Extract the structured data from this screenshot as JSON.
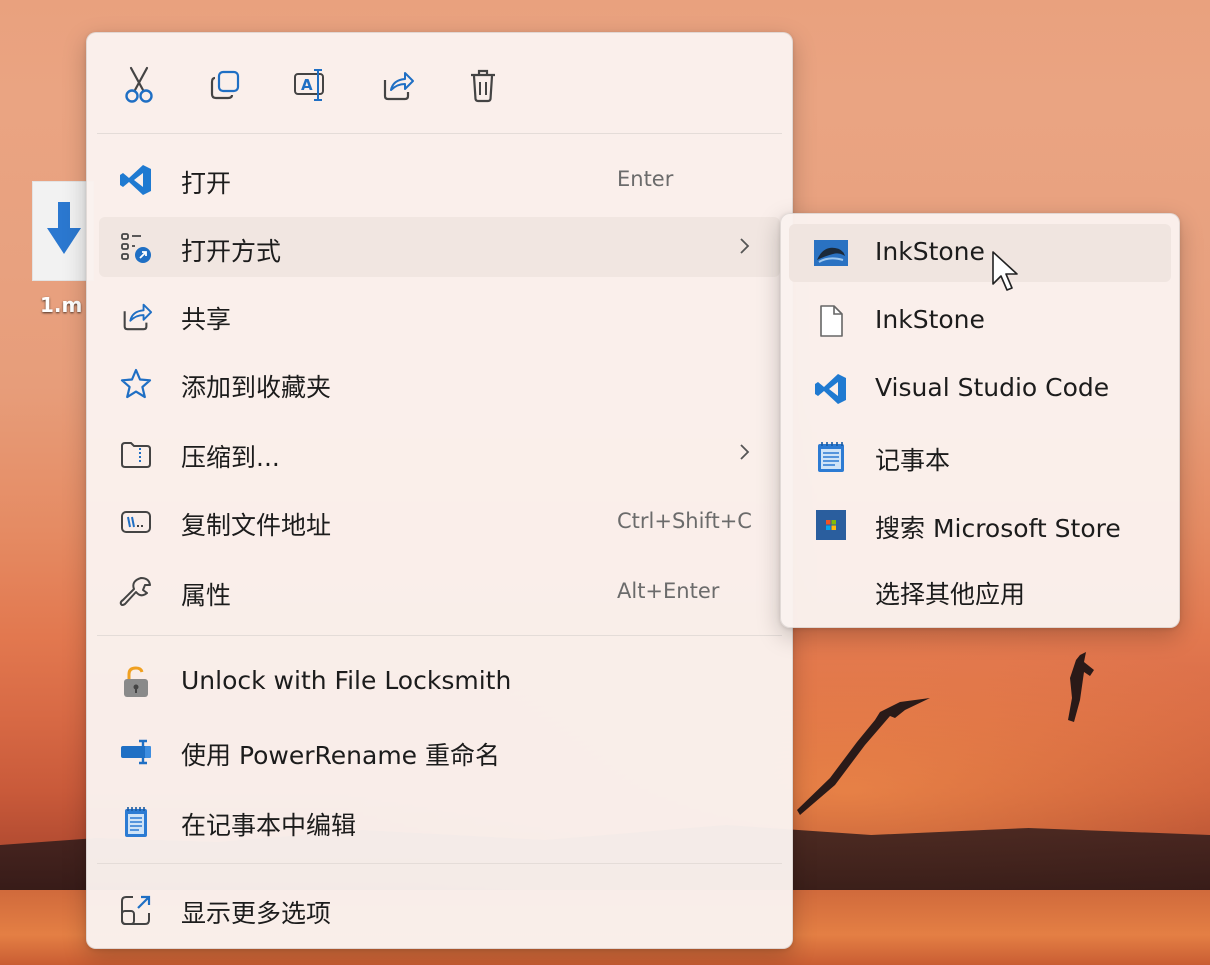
{
  "desktop": {
    "file_label": "1.m"
  },
  "toolbar": {
    "cut": "cut-icon",
    "copy": "copy-icon",
    "rename": "rename-icon",
    "share": "share-icon",
    "delete": "delete-icon"
  },
  "menu": {
    "items": [
      {
        "label": "打开",
        "shortcut": "Enter",
        "icon": "vscode-icon"
      },
      {
        "label": "打开方式",
        "icon": "open-with-icon"
      },
      {
        "label": "共享",
        "icon": "share-icon"
      },
      {
        "label": "添加到收藏夹",
        "icon": "star-icon"
      },
      {
        "label": "压缩到...",
        "icon": "zip-folder-icon"
      },
      {
        "label": "复制文件地址",
        "shortcut": "Ctrl+Shift+C",
        "icon": "copy-path-icon"
      },
      {
        "label": "属性",
        "shortcut": "Alt+Enter",
        "icon": "wrench-icon"
      },
      {
        "label": "Unlock with File Locksmith",
        "icon": "lock-icon"
      },
      {
        "label": "使用 PowerRename 重命名",
        "icon": "powerrename-icon"
      },
      {
        "label": "在记事本中编辑",
        "icon": "notepad-icon"
      },
      {
        "label": "显示更多选项",
        "icon": "more-options-icon"
      }
    ]
  },
  "submenu": {
    "items": [
      {
        "label": "InkStone",
        "icon": "inkstone-icon"
      },
      {
        "label": "InkStone",
        "icon": "file-icon"
      },
      {
        "label": "Visual Studio Code",
        "icon": "vscode-icon"
      },
      {
        "label": "记事本",
        "icon": "notepad-icon"
      },
      {
        "label": "搜索 Microsoft Store",
        "icon": "store-icon"
      },
      {
        "label": "选择其他应用",
        "icon": ""
      }
    ]
  },
  "colors": {
    "accent": "#1f6fc4",
    "menu_bg": "#faf2ee",
    "hover_bg": "#f1e6e1"
  }
}
